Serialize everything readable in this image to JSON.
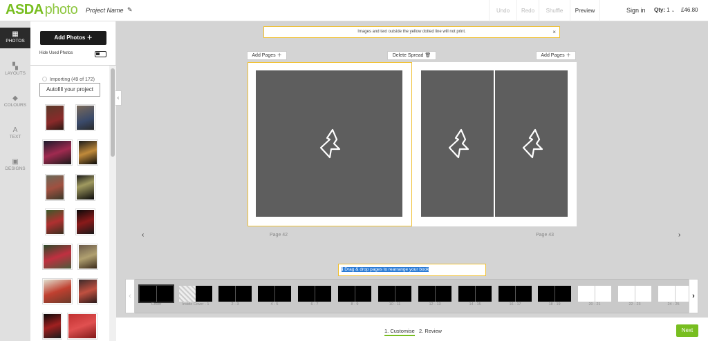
{
  "brand": {
    "name": "ASDA",
    "suffix": "photo",
    "color": "#78be20"
  },
  "header": {
    "project_name": "Project Name",
    "undo": "Undo",
    "redo": "Redo",
    "shuffle": "Shuffle",
    "preview": "Preview",
    "sign_in": "Sign in",
    "qty_label": "Qty:",
    "qty_value": "1",
    "price": "£46.80"
  },
  "leftnav": {
    "items": [
      {
        "label": "PHOTOS",
        "icon": "photos-icon"
      },
      {
        "label": "LAYOUTS",
        "icon": "layouts-icon"
      },
      {
        "label": "COLOURS",
        "icon": "colours-icon"
      },
      {
        "label": "TEXT",
        "icon": "text-icon"
      },
      {
        "label": "DESIGNS",
        "icon": "designs-icon"
      }
    ]
  },
  "photos_panel": {
    "add_photos": "Add Photos",
    "hide_used": "Hide Used Photos",
    "importing": "Importing (49 of 172)",
    "autofill": "Autofill your project"
  },
  "editor": {
    "notice": "Images and text outside the yellow dotted line will not print.",
    "add_pages_left": "Add Pages",
    "delete_spread": "Delete Spread",
    "add_pages_right": "Add Pages",
    "page_left": "Page 42",
    "page_right": "Page 43",
    "drag_tip": "Drag & drop pages to rearrange your book"
  },
  "page_strip": {
    "items": [
      {
        "label": "Cover"
      },
      {
        "label": "Inside Cover - 1"
      },
      {
        "label": "2 - 3"
      },
      {
        "label": "4 - 5"
      },
      {
        "label": "6 - 7"
      },
      {
        "label": "8 - 9"
      },
      {
        "label": "10 - 11"
      },
      {
        "label": "12 - 13"
      },
      {
        "label": "14 - 15"
      },
      {
        "label": "16 - 17"
      },
      {
        "label": "18 - 19"
      },
      {
        "label": "20 - 21"
      },
      {
        "label": "22 - 23"
      },
      {
        "label": "24 - 25"
      }
    ]
  },
  "footer": {
    "step1": "1. Customise",
    "step2": "2. Review",
    "next": "Next"
  }
}
